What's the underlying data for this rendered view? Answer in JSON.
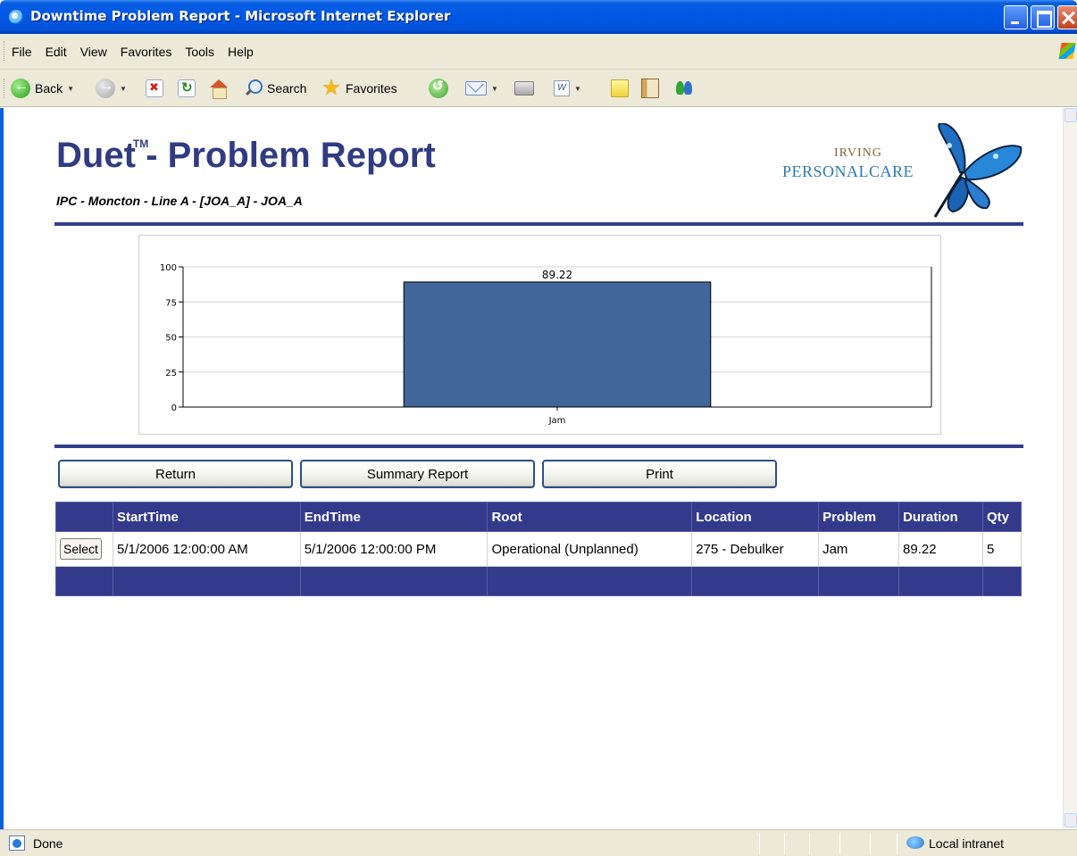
{
  "window": {
    "title": "Downtime Problem Report - Microsoft Internet Explorer"
  },
  "menu": [
    "File",
    "Edit",
    "View",
    "Favorites",
    "Tools",
    "Help"
  ],
  "toolbar": {
    "back": "Back",
    "search": "Search",
    "favorites": "Favorites"
  },
  "report": {
    "title": "Duet",
    "title_tm": "TM",
    "title_rest": "- Problem Report",
    "subtitle": "IPC - Moncton - Line A - [JOA_A] - JOA_A",
    "logo_line1": "IRVING",
    "logo_line2": "PERSONALCARE"
  },
  "chart_data": {
    "type": "bar",
    "categories": [
      "Jam"
    ],
    "values": [
      89.22
    ],
    "data_labels": [
      "89.22"
    ],
    "title": "",
    "xlabel": "",
    "ylabel": "",
    "ylim": [
      0,
      100
    ],
    "yticks": [
      0,
      25,
      50,
      75,
      100
    ],
    "grid": true,
    "bar_color": "#40669a"
  },
  "buttons": {
    "return": "Return",
    "summary": "Summary Report",
    "print": "Print"
  },
  "table": {
    "headers": [
      "",
      "StartTime",
      "EndTime",
      "Root",
      "Location",
      "Problem",
      "Duration",
      "Qty"
    ],
    "rows": [
      {
        "select": "Select",
        "start": "5/1/2006 12:00:00 AM",
        "end": "5/1/2006 12:00:00 PM",
        "root": "Operational (Unplanned)",
        "location": "275 - Debulker",
        "problem": "Jam",
        "duration": "89.22",
        "qty": "5"
      }
    ]
  },
  "status": {
    "left": "Done",
    "zone": "Local intranet"
  },
  "colors": {
    "header_blue": "#333a8c",
    "title_blue": "#303b82",
    "rule": "#333e8e"
  }
}
